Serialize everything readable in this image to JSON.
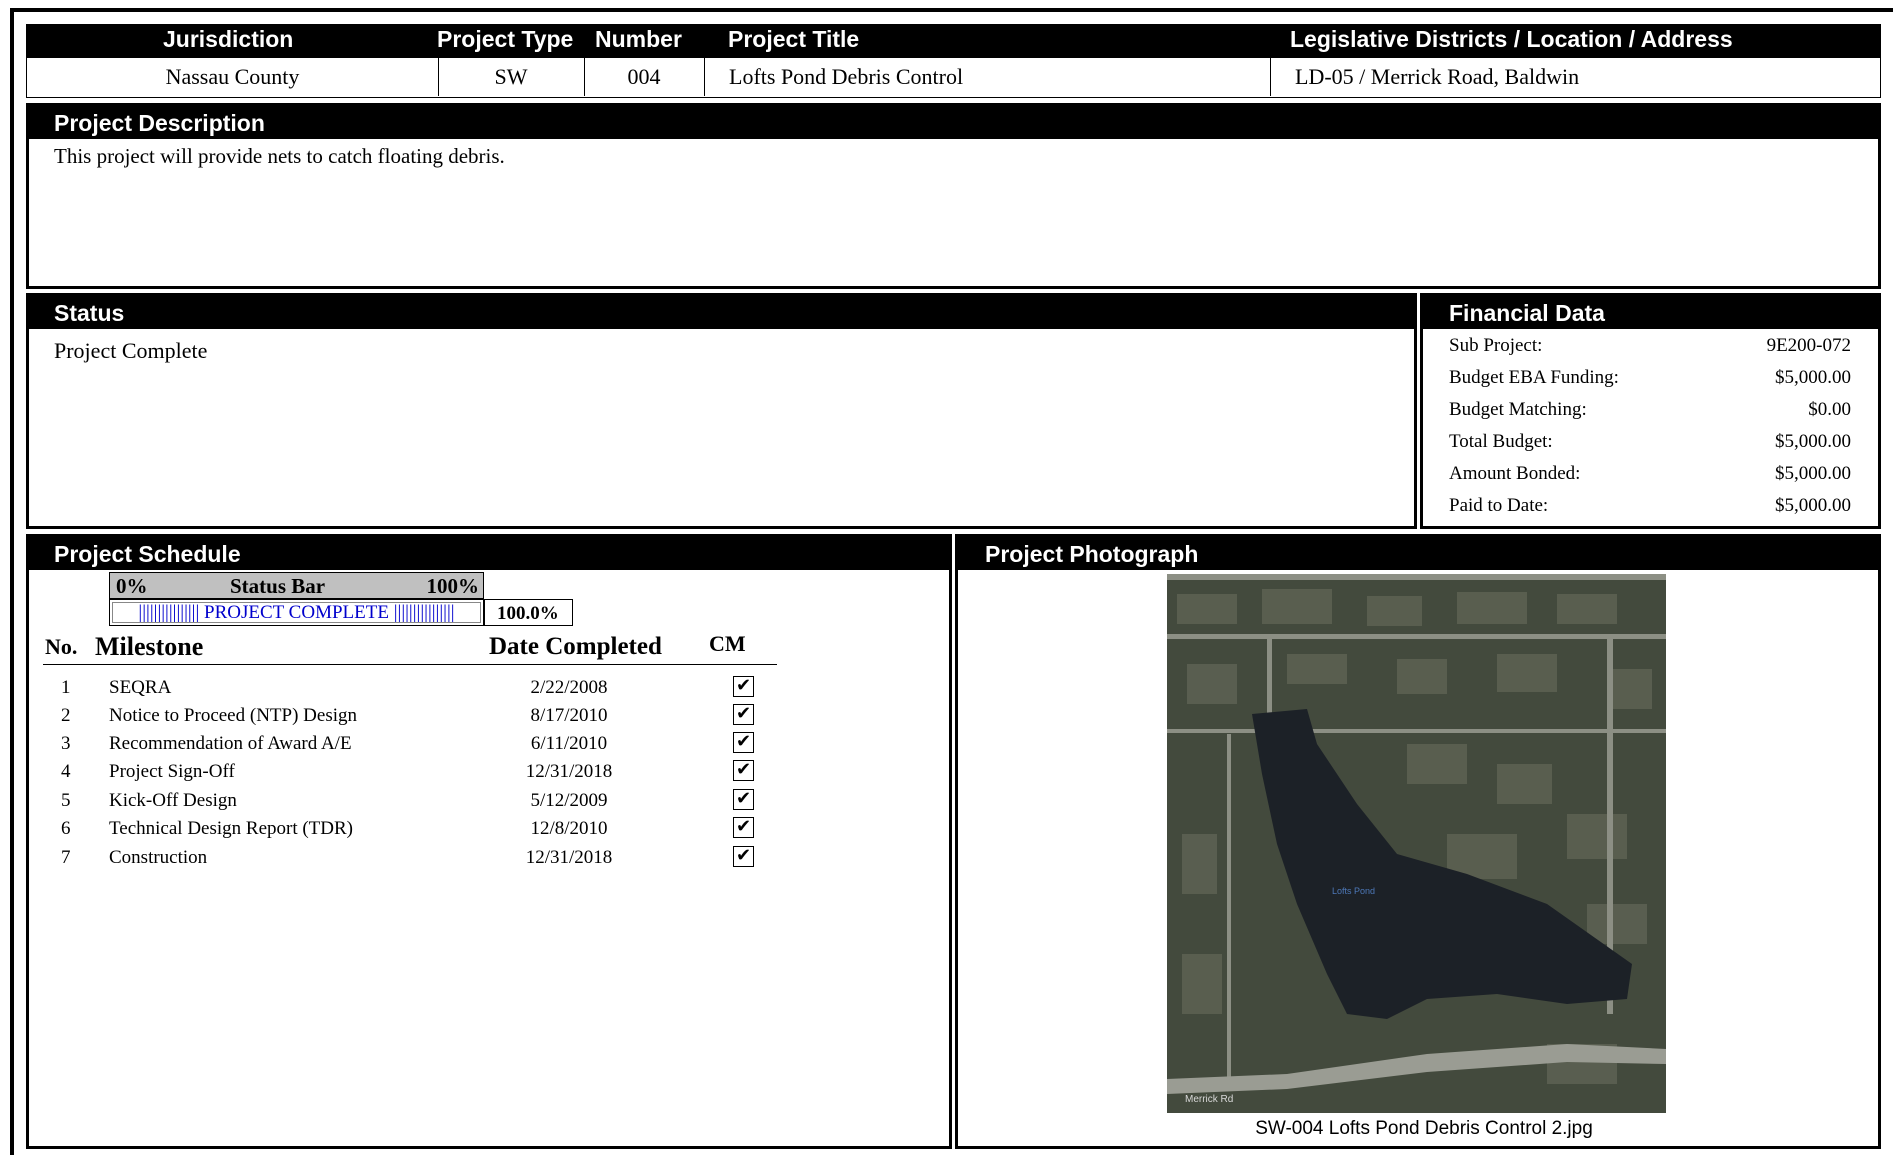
{
  "header": {
    "col_jurisdiction": "Jurisdiction",
    "col_project_type": "Project Type",
    "col_number": "Number",
    "col_project_title": "Project Title",
    "col_location": "Legislative Districts / Location / Address"
  },
  "project": {
    "jurisdiction": "Nassau County",
    "project_type": "SW",
    "number": "004",
    "title": "Lofts Pond Debris Control",
    "location": "LD-05 / Merrick Road, Baldwin"
  },
  "description": {
    "heading": "Project Description",
    "text": "This project will provide nets to catch floating debris."
  },
  "status": {
    "heading": "Status",
    "text": "Project Complete"
  },
  "financial": {
    "heading": "Financial Data",
    "rows": [
      {
        "label": "Sub Project:",
        "value": "9E200-072"
      },
      {
        "label": "Budget EBA Funding:",
        "value": "$5,000.00"
      },
      {
        "label": "Budget Matching:",
        "value": "$0.00"
      },
      {
        "label": "Total Budget:",
        "value": "$5,000.00"
      },
      {
        "label": "Amount Bonded:",
        "value": "$5,000.00"
      },
      {
        "label": "Paid to Date:",
        "value": "$5,000.00"
      }
    ]
  },
  "schedule": {
    "heading": "Project Schedule",
    "status_bar": {
      "left": "0%",
      "title": "Status Bar",
      "right": "100%",
      "fill_text": "|||||||||||||||| PROJECT COMPLETE ||||||||||||||||",
      "percent": "100.0%",
      "progress": 1.0
    },
    "columns": {
      "no": "No.",
      "milestone": "Milestone",
      "date": "Date Completed",
      "cm": "CM"
    },
    "milestones": [
      {
        "no": "1",
        "name": "SEQRA",
        "date": "2/22/2008",
        "cm": "✔"
      },
      {
        "no": "2",
        "name": "Notice to Proceed (NTP) Design",
        "date": "8/17/2010",
        "cm": "✔"
      },
      {
        "no": "3",
        "name": "Recommendation of Award A/E",
        "date": "6/11/2010",
        "cm": "✔"
      },
      {
        "no": "4",
        "name": "Project Sign-Off",
        "date": "12/31/2018",
        "cm": "✔"
      },
      {
        "no": "5",
        "name": "Kick-Off Design",
        "date": "5/12/2009",
        "cm": "✔"
      },
      {
        "no": "6",
        "name": "Technical Design Report (TDR)",
        "date": "12/8/2010",
        "cm": "✔"
      },
      {
        "no": "7",
        "name": "Construction",
        "date": "12/31/2018",
        "cm": "✔"
      }
    ]
  },
  "photo": {
    "heading": "Project Photograph",
    "map_label_pond": "Lofts Pond",
    "map_label_road": "Merrick Rd",
    "caption": "SW-004 Lofts Pond Debris Control 2.jpg"
  }
}
